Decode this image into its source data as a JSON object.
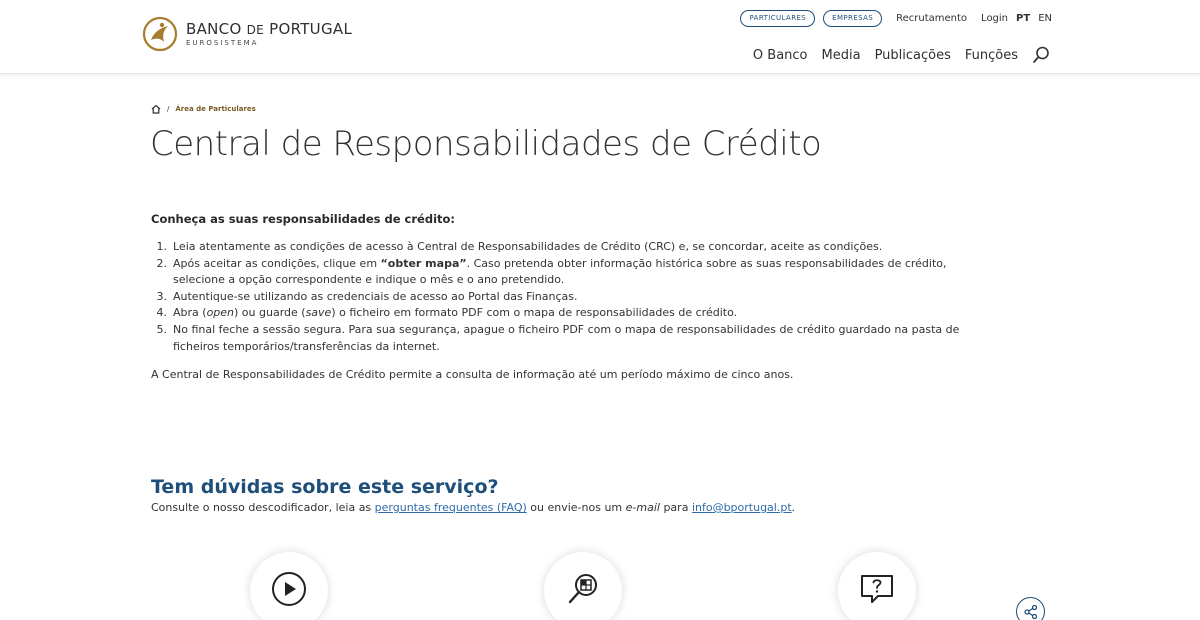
{
  "header": {
    "logo_name_a": "BANCO ",
    "logo_name_de": "DE",
    "logo_name_b": " PORTUGAL",
    "logo_sub": "EUROSISTEMA",
    "pills": [
      "PARTICULARES",
      "EMPRESAS"
    ],
    "recruitment": "Recrutamento",
    "login": "Login",
    "lang_pt": "PT",
    "lang_en": "EN",
    "nav": [
      "O Banco",
      "Media",
      "Publicações",
      "Funções"
    ],
    "search_icon": "search-icon"
  },
  "breadcrumb": {
    "separator": "/",
    "current": "Área de Particulares"
  },
  "page": {
    "title": "Central de Responsabilidades de Crédito",
    "intro_title": "Conheça as suas responsabilidades de crédito:",
    "steps": [
      {
        "num": "1.",
        "a": "Leia atentamente as condições de acesso à Central de Responsabilidades de Crédito (CRC) e, se concordar, aceite as condições."
      },
      {
        "num": "2.",
        "a": "Após aceitar as condições, clique em ",
        "b": "“obter mapa”",
        "c": ". Caso pretenda obter informação histórica sobre as suas responsabilidades de crédito, selecione a opção correspondente e indique o mês e o ano pretendido."
      },
      {
        "num": "3.",
        "a": "Autentique-se utilizando as credenciais de acesso ao Portal das Finanças."
      },
      {
        "num": "4.",
        "a": "Abra (",
        "b": "open",
        "c": ") ou guarde (",
        "d": "save",
        "e": ") o ficheiro em formato PDF com o mapa de responsabilidades de crédito."
      },
      {
        "num": "5.",
        "a": "No final feche a sessão segura. Para sua segurança, apague o ficheiro PDF com o mapa de responsabilidades de crédito guardado na pasta de ficheiros temporários/transferências da internet."
      }
    ],
    "note": "A Central de Responsabilidades de Crédito permite a consulta de informação até um período máximo de cinco anos."
  },
  "faq": {
    "title": "Tem dúvidas sobre este serviço?",
    "text_a": "Consulte o nosso descodificador, leia as ",
    "link_faq": "perguntas frequentes (FAQ)",
    "text_b": " ou envie-nos um ",
    "email_word": "e-mail",
    "text_c": " para ",
    "link_email": "info@bportugal.pt",
    "text_d": "."
  },
  "icons": [
    "play-icon",
    "document-search-icon",
    "question-chat-icon",
    "share-icon"
  ],
  "colors": {
    "brand_blue": "#1d4f7a",
    "link_blue": "#2f6ba8",
    "gold": "#a67c2e"
  }
}
